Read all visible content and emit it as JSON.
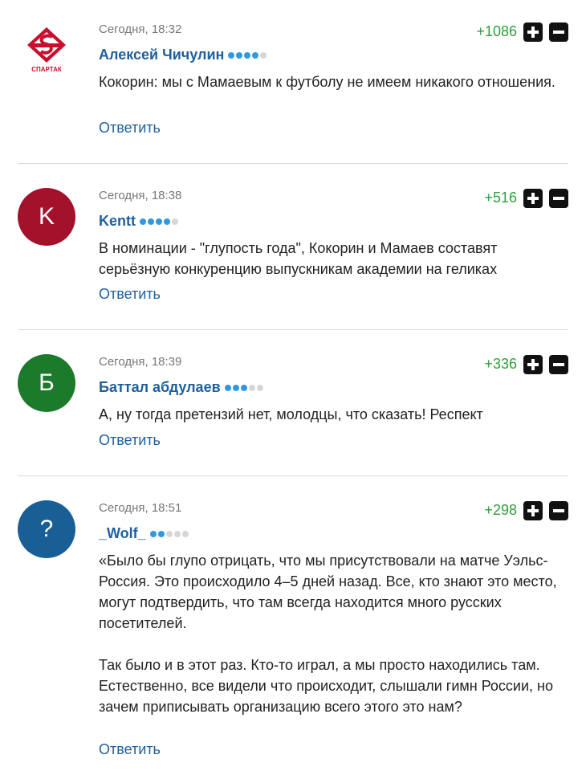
{
  "comments": [
    {
      "time": "Сегодня, 18:32",
      "author": "Алексей Чичулин",
      "rating_dots_filled": 4,
      "rating_dots_total": 5,
      "score": "+1086",
      "avatar": {
        "type": "logo",
        "icon": "spartak-logo-icon",
        "logo_text": "СПАРТАК",
        "colors": [
          "#c8102e",
          "#ffffff"
        ]
      },
      "paragraphs": [
        "Кокорин: мы с Мамаевым к футболу не имеем никакого отношения."
      ],
      "reply_label": "Ответить"
    },
    {
      "time": "Сегодня, 18:38",
      "author": "Kentt",
      "rating_dots_filled": 4,
      "rating_dots_total": 5,
      "score": "+516",
      "avatar": {
        "type": "letter",
        "letter": "K",
        "color": "#a3112b"
      },
      "paragraphs": [
        "В номинации - \"глупость года\", Кокорин и Мамаев составят серьёзную конкуренцию выпускникам академии на геликах"
      ],
      "reply_label": "Ответить"
    },
    {
      "time": "Сегодня, 18:39",
      "author": "Баттал абдулаев",
      "rating_dots_filled": 3,
      "rating_dots_total": 5,
      "score": "+336",
      "avatar": {
        "type": "letter",
        "letter": "Б",
        "color": "#1c7a2b"
      },
      "paragraphs": [
        "А, ну тогда претензий нет, молодцы, что сказать! Респект"
      ],
      "reply_label": "Ответить"
    },
    {
      "time": "Сегодня, 18:51",
      "author": "_Wolf_",
      "rating_dots_filled": 2,
      "rating_dots_total": 5,
      "score": "+298",
      "avatar": {
        "type": "letter",
        "letter": "?",
        "color": "#1a5e96"
      },
      "paragraphs": [
        "«Было бы глупо отрицать, что мы присутствовали на матче Уэльс-Россия. Это происходило 4–5 дней назад. Все, кто знают это место, могут подтвердить, что там всегда находится много русских посетителей.",
        "Так было и в этот раз. Кто-то играл, а мы просто находились там. Естественно, все видели что происходит, слышали гимн России, но зачем приписывать организацию всего этого это нам?"
      ],
      "reply_label": "Ответить"
    }
  ],
  "vote_icons": {
    "plus": "plus-icon",
    "minus": "minus-icon"
  },
  "colors": {
    "author_link": "#1f5f9e",
    "score_positive": "#2e9e3a",
    "rating_dot_on": "#2f9ae0",
    "rating_dot_off": "#d6d6d6"
  }
}
